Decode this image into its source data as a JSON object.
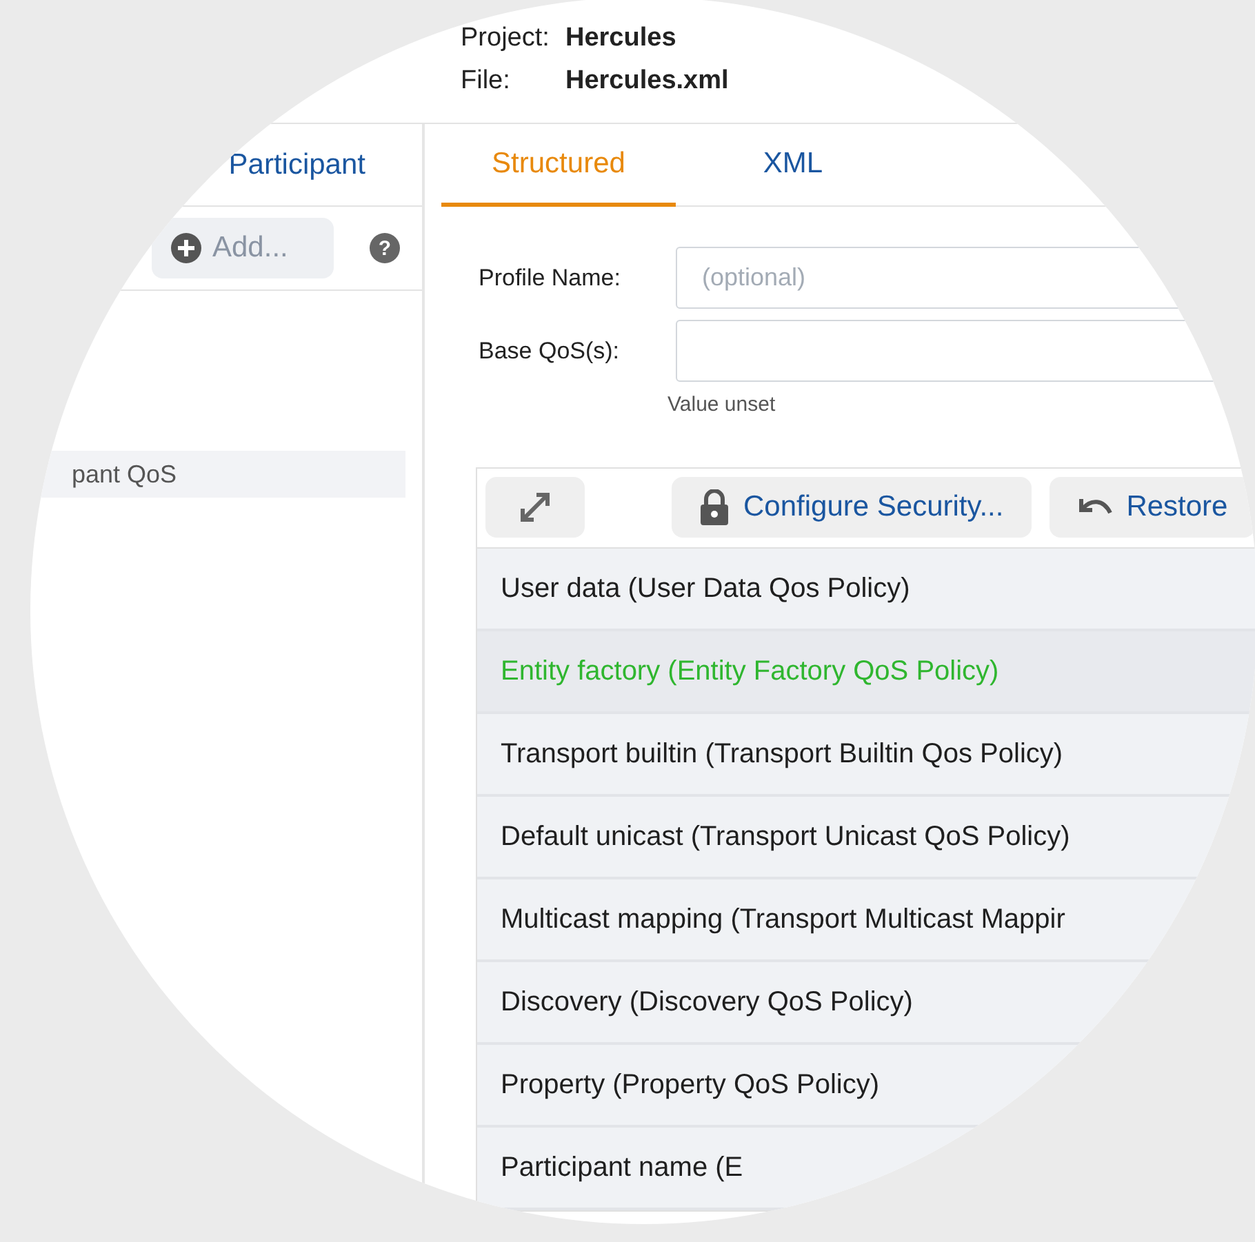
{
  "header": {
    "project_label": "Project:",
    "project": "Hercules",
    "file_label": "File:",
    "file": "Hercules.xml"
  },
  "left_panel": {
    "title": "Participant",
    "add_button": "Add...",
    "help_icon": "?",
    "items": [
      {
        "label": "pant QoS",
        "selected": true
      }
    ]
  },
  "tabs": [
    {
      "label": "Structured",
      "selected": true
    },
    {
      "label": "XML",
      "selected": false
    }
  ],
  "form": {
    "fields": [
      {
        "label": "Profile Name:",
        "placeholder": "(optional)"
      },
      {
        "label": "Base QoS(s):",
        "hint": "Value unset"
      }
    ]
  },
  "toolbar": {
    "buttons": [
      "Configure Security...",
      "Restore"
    ]
  },
  "policies": [
    {
      "label": "User data (User Data Qos Policy)",
      "modified": false
    },
    {
      "label": "Entity factory (Entity Factory QoS Policy)",
      "modified": true
    },
    {
      "label": "Transport builtin (Transport Builtin Qos Policy)",
      "modified": false
    },
    {
      "label": "Default unicast (Transport Unicast QoS Policy)",
      "modified": false
    },
    {
      "label": "Multicast mapping (Transport Multicast Mappir",
      "modified": false
    },
    {
      "label": "Discovery (Discovery QoS Policy)",
      "modified": false
    },
    {
      "label": "Property (Property QoS Policy)",
      "modified": false
    },
    {
      "label": "Participant name (E",
      "modified": false
    }
  ]
}
